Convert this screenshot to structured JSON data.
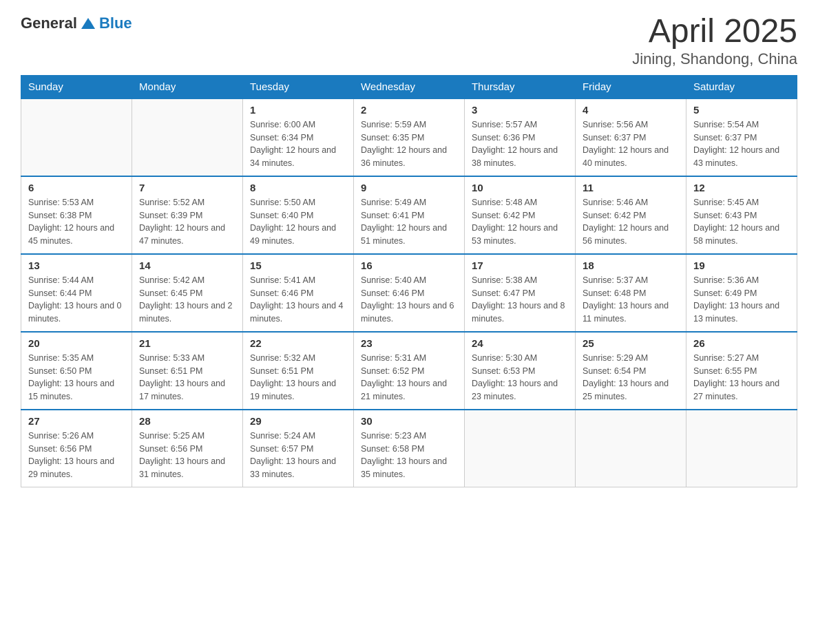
{
  "logo": {
    "text_general": "General",
    "text_blue": "Blue"
  },
  "header": {
    "title": "April 2025",
    "subtitle": "Jining, Shandong, China"
  },
  "days_of_week": [
    "Sunday",
    "Monday",
    "Tuesday",
    "Wednesday",
    "Thursday",
    "Friday",
    "Saturday"
  ],
  "weeks": [
    [
      {
        "day": "",
        "sunrise": "",
        "sunset": "",
        "daylight": ""
      },
      {
        "day": "",
        "sunrise": "",
        "sunset": "",
        "daylight": ""
      },
      {
        "day": "1",
        "sunrise": "Sunrise: 6:00 AM",
        "sunset": "Sunset: 6:34 PM",
        "daylight": "Daylight: 12 hours and 34 minutes."
      },
      {
        "day": "2",
        "sunrise": "Sunrise: 5:59 AM",
        "sunset": "Sunset: 6:35 PM",
        "daylight": "Daylight: 12 hours and 36 minutes."
      },
      {
        "day": "3",
        "sunrise": "Sunrise: 5:57 AM",
        "sunset": "Sunset: 6:36 PM",
        "daylight": "Daylight: 12 hours and 38 minutes."
      },
      {
        "day": "4",
        "sunrise": "Sunrise: 5:56 AM",
        "sunset": "Sunset: 6:37 PM",
        "daylight": "Daylight: 12 hours and 40 minutes."
      },
      {
        "day": "5",
        "sunrise": "Sunrise: 5:54 AM",
        "sunset": "Sunset: 6:37 PM",
        "daylight": "Daylight: 12 hours and 43 minutes."
      }
    ],
    [
      {
        "day": "6",
        "sunrise": "Sunrise: 5:53 AM",
        "sunset": "Sunset: 6:38 PM",
        "daylight": "Daylight: 12 hours and 45 minutes."
      },
      {
        "day": "7",
        "sunrise": "Sunrise: 5:52 AM",
        "sunset": "Sunset: 6:39 PM",
        "daylight": "Daylight: 12 hours and 47 minutes."
      },
      {
        "day": "8",
        "sunrise": "Sunrise: 5:50 AM",
        "sunset": "Sunset: 6:40 PM",
        "daylight": "Daylight: 12 hours and 49 minutes."
      },
      {
        "day": "9",
        "sunrise": "Sunrise: 5:49 AM",
        "sunset": "Sunset: 6:41 PM",
        "daylight": "Daylight: 12 hours and 51 minutes."
      },
      {
        "day": "10",
        "sunrise": "Sunrise: 5:48 AM",
        "sunset": "Sunset: 6:42 PM",
        "daylight": "Daylight: 12 hours and 53 minutes."
      },
      {
        "day": "11",
        "sunrise": "Sunrise: 5:46 AM",
        "sunset": "Sunset: 6:42 PM",
        "daylight": "Daylight: 12 hours and 56 minutes."
      },
      {
        "day": "12",
        "sunrise": "Sunrise: 5:45 AM",
        "sunset": "Sunset: 6:43 PM",
        "daylight": "Daylight: 12 hours and 58 minutes."
      }
    ],
    [
      {
        "day": "13",
        "sunrise": "Sunrise: 5:44 AM",
        "sunset": "Sunset: 6:44 PM",
        "daylight": "Daylight: 13 hours and 0 minutes."
      },
      {
        "day": "14",
        "sunrise": "Sunrise: 5:42 AM",
        "sunset": "Sunset: 6:45 PM",
        "daylight": "Daylight: 13 hours and 2 minutes."
      },
      {
        "day": "15",
        "sunrise": "Sunrise: 5:41 AM",
        "sunset": "Sunset: 6:46 PM",
        "daylight": "Daylight: 13 hours and 4 minutes."
      },
      {
        "day": "16",
        "sunrise": "Sunrise: 5:40 AM",
        "sunset": "Sunset: 6:46 PM",
        "daylight": "Daylight: 13 hours and 6 minutes."
      },
      {
        "day": "17",
        "sunrise": "Sunrise: 5:38 AM",
        "sunset": "Sunset: 6:47 PM",
        "daylight": "Daylight: 13 hours and 8 minutes."
      },
      {
        "day": "18",
        "sunrise": "Sunrise: 5:37 AM",
        "sunset": "Sunset: 6:48 PM",
        "daylight": "Daylight: 13 hours and 11 minutes."
      },
      {
        "day": "19",
        "sunrise": "Sunrise: 5:36 AM",
        "sunset": "Sunset: 6:49 PM",
        "daylight": "Daylight: 13 hours and 13 minutes."
      }
    ],
    [
      {
        "day": "20",
        "sunrise": "Sunrise: 5:35 AM",
        "sunset": "Sunset: 6:50 PM",
        "daylight": "Daylight: 13 hours and 15 minutes."
      },
      {
        "day": "21",
        "sunrise": "Sunrise: 5:33 AM",
        "sunset": "Sunset: 6:51 PM",
        "daylight": "Daylight: 13 hours and 17 minutes."
      },
      {
        "day": "22",
        "sunrise": "Sunrise: 5:32 AM",
        "sunset": "Sunset: 6:51 PM",
        "daylight": "Daylight: 13 hours and 19 minutes."
      },
      {
        "day": "23",
        "sunrise": "Sunrise: 5:31 AM",
        "sunset": "Sunset: 6:52 PM",
        "daylight": "Daylight: 13 hours and 21 minutes."
      },
      {
        "day": "24",
        "sunrise": "Sunrise: 5:30 AM",
        "sunset": "Sunset: 6:53 PM",
        "daylight": "Daylight: 13 hours and 23 minutes."
      },
      {
        "day": "25",
        "sunrise": "Sunrise: 5:29 AM",
        "sunset": "Sunset: 6:54 PM",
        "daylight": "Daylight: 13 hours and 25 minutes."
      },
      {
        "day": "26",
        "sunrise": "Sunrise: 5:27 AM",
        "sunset": "Sunset: 6:55 PM",
        "daylight": "Daylight: 13 hours and 27 minutes."
      }
    ],
    [
      {
        "day": "27",
        "sunrise": "Sunrise: 5:26 AM",
        "sunset": "Sunset: 6:56 PM",
        "daylight": "Daylight: 13 hours and 29 minutes."
      },
      {
        "day": "28",
        "sunrise": "Sunrise: 5:25 AM",
        "sunset": "Sunset: 6:56 PM",
        "daylight": "Daylight: 13 hours and 31 minutes."
      },
      {
        "day": "29",
        "sunrise": "Sunrise: 5:24 AM",
        "sunset": "Sunset: 6:57 PM",
        "daylight": "Daylight: 13 hours and 33 minutes."
      },
      {
        "day": "30",
        "sunrise": "Sunrise: 5:23 AM",
        "sunset": "Sunset: 6:58 PM",
        "daylight": "Daylight: 13 hours and 35 minutes."
      },
      {
        "day": "",
        "sunrise": "",
        "sunset": "",
        "daylight": ""
      },
      {
        "day": "",
        "sunrise": "",
        "sunset": "",
        "daylight": ""
      },
      {
        "day": "",
        "sunrise": "",
        "sunset": "",
        "daylight": ""
      }
    ]
  ]
}
